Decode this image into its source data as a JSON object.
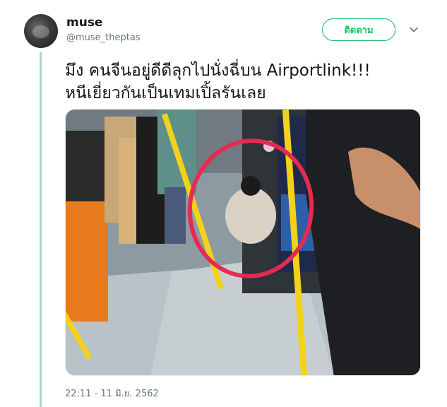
{
  "tweet": {
    "display_name": "muse",
    "handle": "@muse_theptas",
    "follow_label": "ติดตาม",
    "text_lines": [
      "มึง คนจีนอยู่ดีดีลุกไปนั่งฉี่บน Airportlink!!!",
      "หนีเยี่ยวกันเป็นเทมเปิ้ลรันเลย"
    ],
    "timestamp": "22:11 - 11 มิ.ย. 2562"
  },
  "colors": {
    "accent_green": "#17bf63",
    "thread_line": "#a6d6cf",
    "secondary_text": "#657786",
    "primary_text": "#14171a"
  },
  "icons": {
    "caret": "chevron-down-icon"
  }
}
